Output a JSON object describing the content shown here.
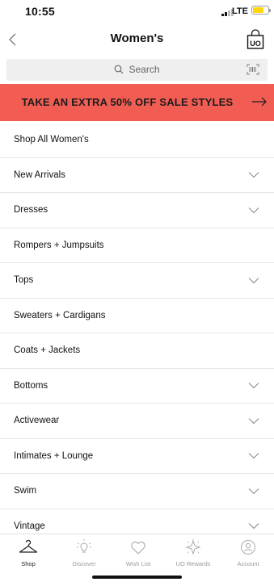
{
  "status": {
    "time": "10:55",
    "network": "LTE",
    "battery_color": "#ffd60a"
  },
  "header": {
    "title": "Women's",
    "back_icon": "chevron-left-icon",
    "bag_icon": "shopping-bag-icon",
    "bag_label": "UO"
  },
  "search": {
    "label": "Search",
    "barcode_icon": "barcode-scan-icon"
  },
  "banner": {
    "text": "TAKE AN EXTRA 50% OFF SALE STYLES",
    "color": "#f25d53",
    "arrow_icon": "arrow-right-icon"
  },
  "menu": {
    "items": [
      {
        "label": "Shop All Women's",
        "expandable": false
      },
      {
        "label": "New Arrivals",
        "expandable": true
      },
      {
        "label": "Dresses",
        "expandable": true
      },
      {
        "label": "Rompers + Jumpsuits",
        "expandable": false
      },
      {
        "label": "Tops",
        "expandable": true
      },
      {
        "label": "Sweaters + Cardigans",
        "expandable": false
      },
      {
        "label": "Coats + Jackets",
        "expandable": false
      },
      {
        "label": "Bottoms",
        "expandable": true
      },
      {
        "label": "Activewear",
        "expandable": true
      },
      {
        "label": "Intimates + Lounge",
        "expandable": true
      },
      {
        "label": "Swim",
        "expandable": true
      },
      {
        "label": "Vintage",
        "expandable": true
      }
    ]
  },
  "tabbar": {
    "tabs": [
      {
        "label": "Shop",
        "icon": "hanger-icon",
        "active": true
      },
      {
        "label": "Discover",
        "icon": "lightbulb-icon",
        "active": false
      },
      {
        "label": "Wish List",
        "icon": "heart-icon",
        "active": false
      },
      {
        "label": "UO Rewards",
        "icon": "sparkle-icon",
        "active": false
      },
      {
        "label": "Account",
        "icon": "account-icon",
        "active": false
      }
    ]
  }
}
